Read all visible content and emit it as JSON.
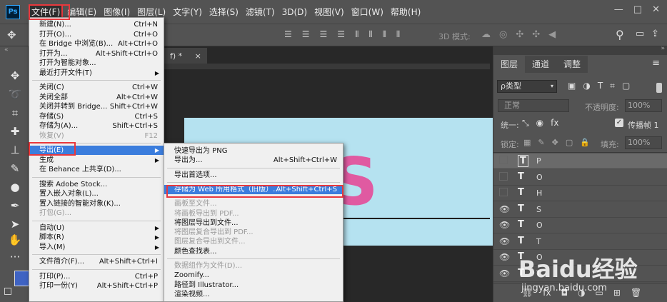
{
  "menubar": {
    "logo": "Ps",
    "items": [
      "文件(F)",
      "编辑(E)",
      "图像(I)",
      "图层(L)",
      "文字(Y)",
      "选择(S)",
      "滤镜(T)",
      "3D(D)",
      "视图(V)",
      "窗口(W)",
      "帮助(H)"
    ],
    "win": [
      "—",
      "□",
      "✕"
    ]
  },
  "optbar": {
    "mode3d": "3D 模式:"
  },
  "doc": {
    "tab": "f) *",
    "canvas_text": "OTOS"
  },
  "file_menu": [
    {
      "label": "新建(N)...",
      "sc": "Ctrl+N"
    },
    {
      "label": "打开(O)...",
      "sc": "Ctrl+O"
    },
    {
      "label": "在 Bridge 中浏览(B)...",
      "sc": "Alt+Ctrl+O"
    },
    {
      "label": "打开为...",
      "sc": "Alt+Shift+Ctrl+O"
    },
    {
      "label": "打开为智能对象...",
      "sc": ""
    },
    {
      "label": "最近打开文件(T)",
      "sc": "",
      "arrow": true
    },
    {
      "sep": true
    },
    {
      "label": "关闭(C)",
      "sc": "Ctrl+W"
    },
    {
      "label": "关闭全部",
      "sc": "Alt+Ctrl+W"
    },
    {
      "label": "关闭并转到 Bridge...",
      "sc": "Shift+Ctrl+W"
    },
    {
      "label": "存储(S)",
      "sc": "Ctrl+S"
    },
    {
      "label": "存储为(A)...",
      "sc": "Shift+Ctrl+S"
    },
    {
      "label": "恢复(V)",
      "sc": "F12",
      "dis": true
    },
    {
      "sep": true
    },
    {
      "label": "导出(E)",
      "sc": "",
      "arrow": true,
      "hl": true
    },
    {
      "label": "生成",
      "sc": "",
      "arrow": true
    },
    {
      "label": "在 Behance 上共享(D)...",
      "sc": ""
    },
    {
      "sep": true
    },
    {
      "label": "搜索 Adobe Stock...",
      "sc": ""
    },
    {
      "label": "置入嵌入对象(L)...",
      "sc": ""
    },
    {
      "label": "置入链接的智能对象(K)...",
      "sc": ""
    },
    {
      "label": "打包(G)...",
      "sc": "",
      "dis": true
    },
    {
      "sep": true
    },
    {
      "label": "自动(U)",
      "sc": "",
      "arrow": true
    },
    {
      "label": "脚本(R)",
      "sc": "",
      "arrow": true
    },
    {
      "label": "导入(M)",
      "sc": "",
      "arrow": true
    },
    {
      "sep": true
    },
    {
      "label": "文件简介(F)...",
      "sc": "Alt+Shift+Ctrl+I"
    },
    {
      "sep": true
    },
    {
      "label": "打印(P)...",
      "sc": "Ctrl+P"
    },
    {
      "label": "打印一份(Y)",
      "sc": "Alt+Shift+Ctrl+P"
    }
  ],
  "export_menu": [
    {
      "label": "快速导出为 PNG",
      "sc": ""
    },
    {
      "label": "导出为...",
      "sc": "Alt+Shift+Ctrl+W"
    },
    {
      "sep": true
    },
    {
      "label": "导出首选项...",
      "sc": ""
    },
    {
      "sep": true
    },
    {
      "label": "存储为 Web 所用格式（旧版）...",
      "sc": "Alt+Shift+Ctrl+S",
      "hl": true
    },
    {
      "sep": true
    },
    {
      "label": "画板至文件...",
      "sc": "",
      "dis": true
    },
    {
      "label": "将画板导出到 PDF...",
      "sc": "",
      "dis": true
    },
    {
      "label": "将图层导出到文件...",
      "sc": ""
    },
    {
      "label": "将图层复合导出到 PDF...",
      "sc": "",
      "dis": true
    },
    {
      "label": "图层复合导出到文件...",
      "sc": "",
      "dis": true
    },
    {
      "label": "颜色查找表...",
      "sc": ""
    },
    {
      "sep": true
    },
    {
      "label": "数据组作为文件(D)...",
      "sc": "",
      "dis": true
    },
    {
      "label": "Zoomify...",
      "sc": ""
    },
    {
      "label": "路径到 Illustrator...",
      "sc": ""
    },
    {
      "label": "渲染视频...",
      "sc": ""
    }
  ],
  "panel": {
    "tabs": [
      "图层",
      "通道",
      "调整"
    ],
    "filter": "ρ类型",
    "blend": "正常",
    "opacity_label": "不透明度:",
    "opacity": "100%",
    "unify": "统一:",
    "propagate": "传播帧 1",
    "lock": "锁定:",
    "fill_label": "填充:",
    "fill": "100%",
    "layers": [
      "P",
      "O",
      "H",
      "S",
      "O",
      "T",
      "O",
      "T"
    ]
  },
  "watermark": {
    "brand": "Baidu经验",
    "url": "jingyan.baidu.com"
  }
}
